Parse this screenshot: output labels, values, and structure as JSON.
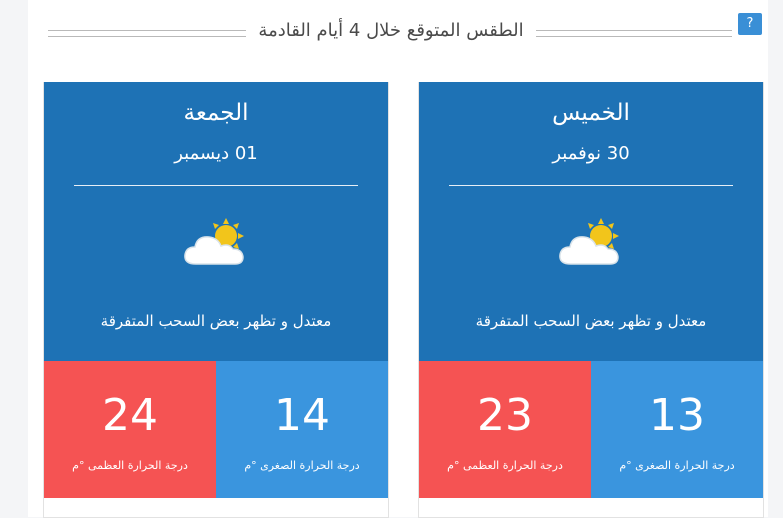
{
  "header": {
    "title": "الطقس المتوقع خلال 4 أيام القادمة",
    "help_label": "?"
  },
  "forecast": [
    {
      "day": "الجمعة",
      "date": "01 ديسمبر",
      "icon": "partly-cloudy-icon",
      "description": "معتدل و تظهر بعض السحب المتفرقة",
      "max_temp": "24",
      "max_label": "درجة الحرارة العظمى °م",
      "min_temp": "14",
      "min_label": "درجة الحرارة الصغرى °م"
    },
    {
      "day": "الخميس",
      "date": "30 نوفمبر",
      "icon": "partly-cloudy-icon",
      "description": "معتدل و تظهر بعض السحب المتفرقة",
      "max_temp": "23",
      "max_label": "درجة الحرارة العظمى °م",
      "min_temp": "13",
      "min_label": "درجة الحرارة الصغرى °م"
    }
  ],
  "colors": {
    "card_header": "#1e72b5",
    "max_bg": "#f55353",
    "min_bg": "#3a95de",
    "help_bg": "#3a8fd6"
  }
}
